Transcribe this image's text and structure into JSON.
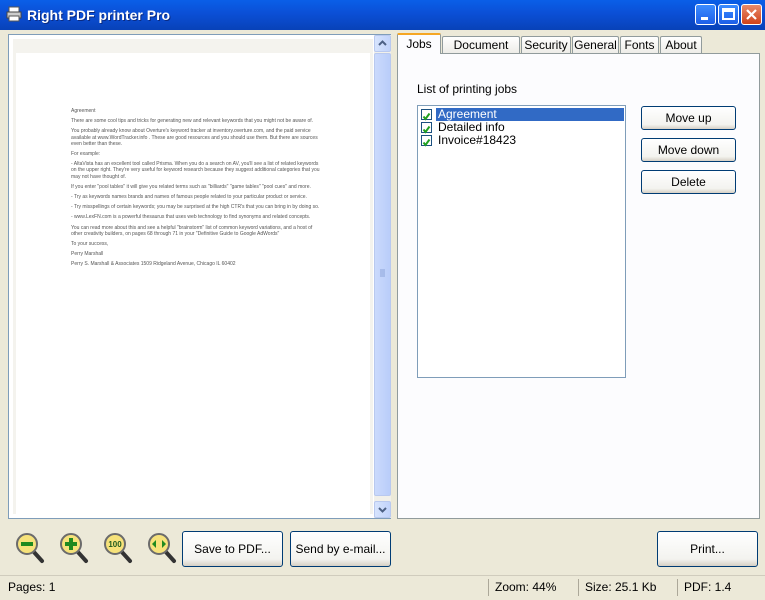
{
  "window": {
    "title": "Right PDF printer Pro"
  },
  "tabs": [
    {
      "label": "Jobs",
      "active": true
    },
    {
      "label": "Document info"
    },
    {
      "label": "Security"
    },
    {
      "label": "General"
    },
    {
      "label": "Fonts"
    },
    {
      "label": "About"
    }
  ],
  "jobs_panel": {
    "list_title": "List of printing jobs",
    "jobs": [
      {
        "label": "Agreement",
        "checked": true,
        "selected": true
      },
      {
        "label": "Detailed info",
        "checked": true
      },
      {
        "label": "Invoice#18423",
        "checked": true
      }
    ],
    "move_up_label": "Move up",
    "move_down_label": "Move down",
    "delete_label": "Delete"
  },
  "preview": {
    "paragraphs": [
      "Agreement",
      "There are some cool tips and tricks for generating new and relevant keywords that you might not be aware of.",
      "You probably already know about Overture's keyword tracker at inventory.overture.com, and the paid service available at www.WordTracker.info . These are good resources and you should use them. But there are sources even better than these.",
      "For example:",
      "- AltaVista has an excellent tool called Prisma. When you do a search on AV, you'll see a list of related keywords on the upper right. They're very useful for keyword research because they suggest additional categories that you may not have thought of.",
      "If you enter \"pool tables\" it will give you related terms such as \"billiards\" \"game tables\" \"pool cues\" and more.",
      "- Try as keywords names brands and names of famous people related to your particular product or service.",
      "- Try misspellings of certain keywords; you may be surprised at the high CTR's that you can bring in by doing so.",
      "- www.LexFN.com is a powerful thesaurus that uses web technology to find synonyms and related concepts.",
      "You can read more about this and see a helpful \"brainstorm\" list of common keyword variations, and a host of other creativity builders, on pages 68 through 71 in your \"Definitive Guide to Google AdWords\"",
      "To your success,",
      "Perry Marshall",
      "Perry S. Marshall & Associates 1509 Ridgeland Avenue, Chicago IL 60402"
    ]
  },
  "toolbar": {
    "zoom_out_icon": "zoom-out-icon",
    "zoom_in_icon": "zoom-in-icon",
    "zoom_100_label": "100",
    "fit_width_icon": "fit-width-icon",
    "save_label": "Save to PDF...",
    "email_label": "Send by e-mail...",
    "print_label": "Print..."
  },
  "status": {
    "pages": "Pages: 1",
    "zoom": "Zoom: 44%",
    "size": "Size: 25.1 Kb",
    "pdf": "PDF: 1.4"
  },
  "colors": {
    "title_bar": "#0b4fd6",
    "selection": "#316ac5",
    "tab_highlight": "#f5a623"
  }
}
